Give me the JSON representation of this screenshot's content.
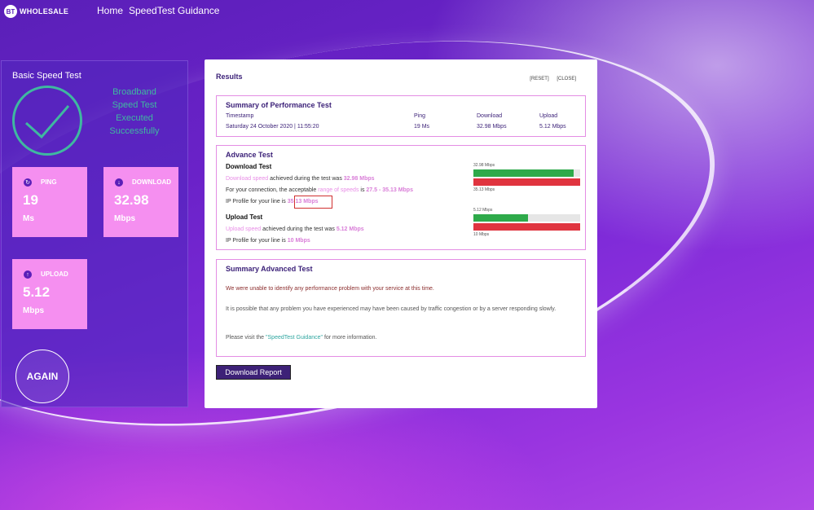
{
  "header": {
    "logo_mark": "BT",
    "logo_text": "WHOLESALE",
    "nav": [
      "Home",
      "SpeedTest Guidance"
    ]
  },
  "left": {
    "title": "Basic Speed Test",
    "status_lines": [
      "Broadband",
      "Speed Test",
      "Executed",
      "Successfully"
    ],
    "tiles": [
      {
        "icon": "refresh-icon",
        "label": "PING",
        "value": "19",
        "unit": "Ms"
      },
      {
        "icon": "download-arrow-icon",
        "label": "DOWNLOAD",
        "value": "32.98",
        "unit": "Mbps"
      },
      {
        "icon": "upload-arrow-icon",
        "label": "UPLOAD",
        "value": "5.12",
        "unit": "Mbps"
      }
    ],
    "again": "AGAIN"
  },
  "results": {
    "title": "Results",
    "reset": "[RESET]",
    "close": "[CLOSE]",
    "summary": {
      "title": "Summary of Performance Test",
      "timestamp_label": "Timestamp",
      "timestamp": "Saturday 24 October 2020 | 11:55:20",
      "ping_label": "Ping",
      "ping": "19 Ms",
      "download_label": "Download",
      "download": "32.98 Mbps",
      "upload_label": "Upload",
      "upload": "5.12 Mbps"
    },
    "advance": {
      "title": "Advance Test",
      "download_heading": "Download Test",
      "dl_line1_a": "Download speed",
      "dl_line1_b": " achieved during the test was ",
      "dl_line1_c": "32.98 Mbps",
      "dl_line2_a": "For your connection, the acceptable ",
      "dl_line2_b": "range of speeds",
      "dl_line2_c": " is ",
      "dl_line2_d": "27.5 - 35.13 Mbps",
      "dl_line3_a": "IP Profile for your line is ",
      "dl_line3_b": "35.13 Mbps",
      "upload_heading": "Upload Test",
      "ul_line1_a": "Upload speed",
      "ul_line1_b": " achieved during the test was ",
      "ul_line1_c": "5.12 Mbps",
      "ul_line2_a": "IP Profile for your line is ",
      "ul_line2_b": "10 Mbps",
      "dl_bar": {
        "top_label": "32.98 Mbps",
        "bottom_label": "35.13 Mbps",
        "fill": 0.939
      },
      "ul_bar": {
        "top_label": "5.12 Mbps",
        "bottom_label": "10 Mbps",
        "fill": 0.512
      }
    },
    "summary_adv": {
      "title": "Summary Advanced Test",
      "p1": "We were unable to identify any performance problem with your service at this time.",
      "p2": "It is possible that any problem you have experienced may have been caused by traffic congestion or by a server responding slowly.",
      "p3_a": "Please visit the ",
      "p3_b": "\"SpeedTest Guidance\"",
      "p3_c": " for more information."
    },
    "download_report": "Download Report"
  },
  "colors": {
    "accent_pink": "#f58ff0",
    "teal": "#3fb8a0",
    "green": "#2eaa4a",
    "red": "#e0343f",
    "navy": "#3d2177"
  }
}
